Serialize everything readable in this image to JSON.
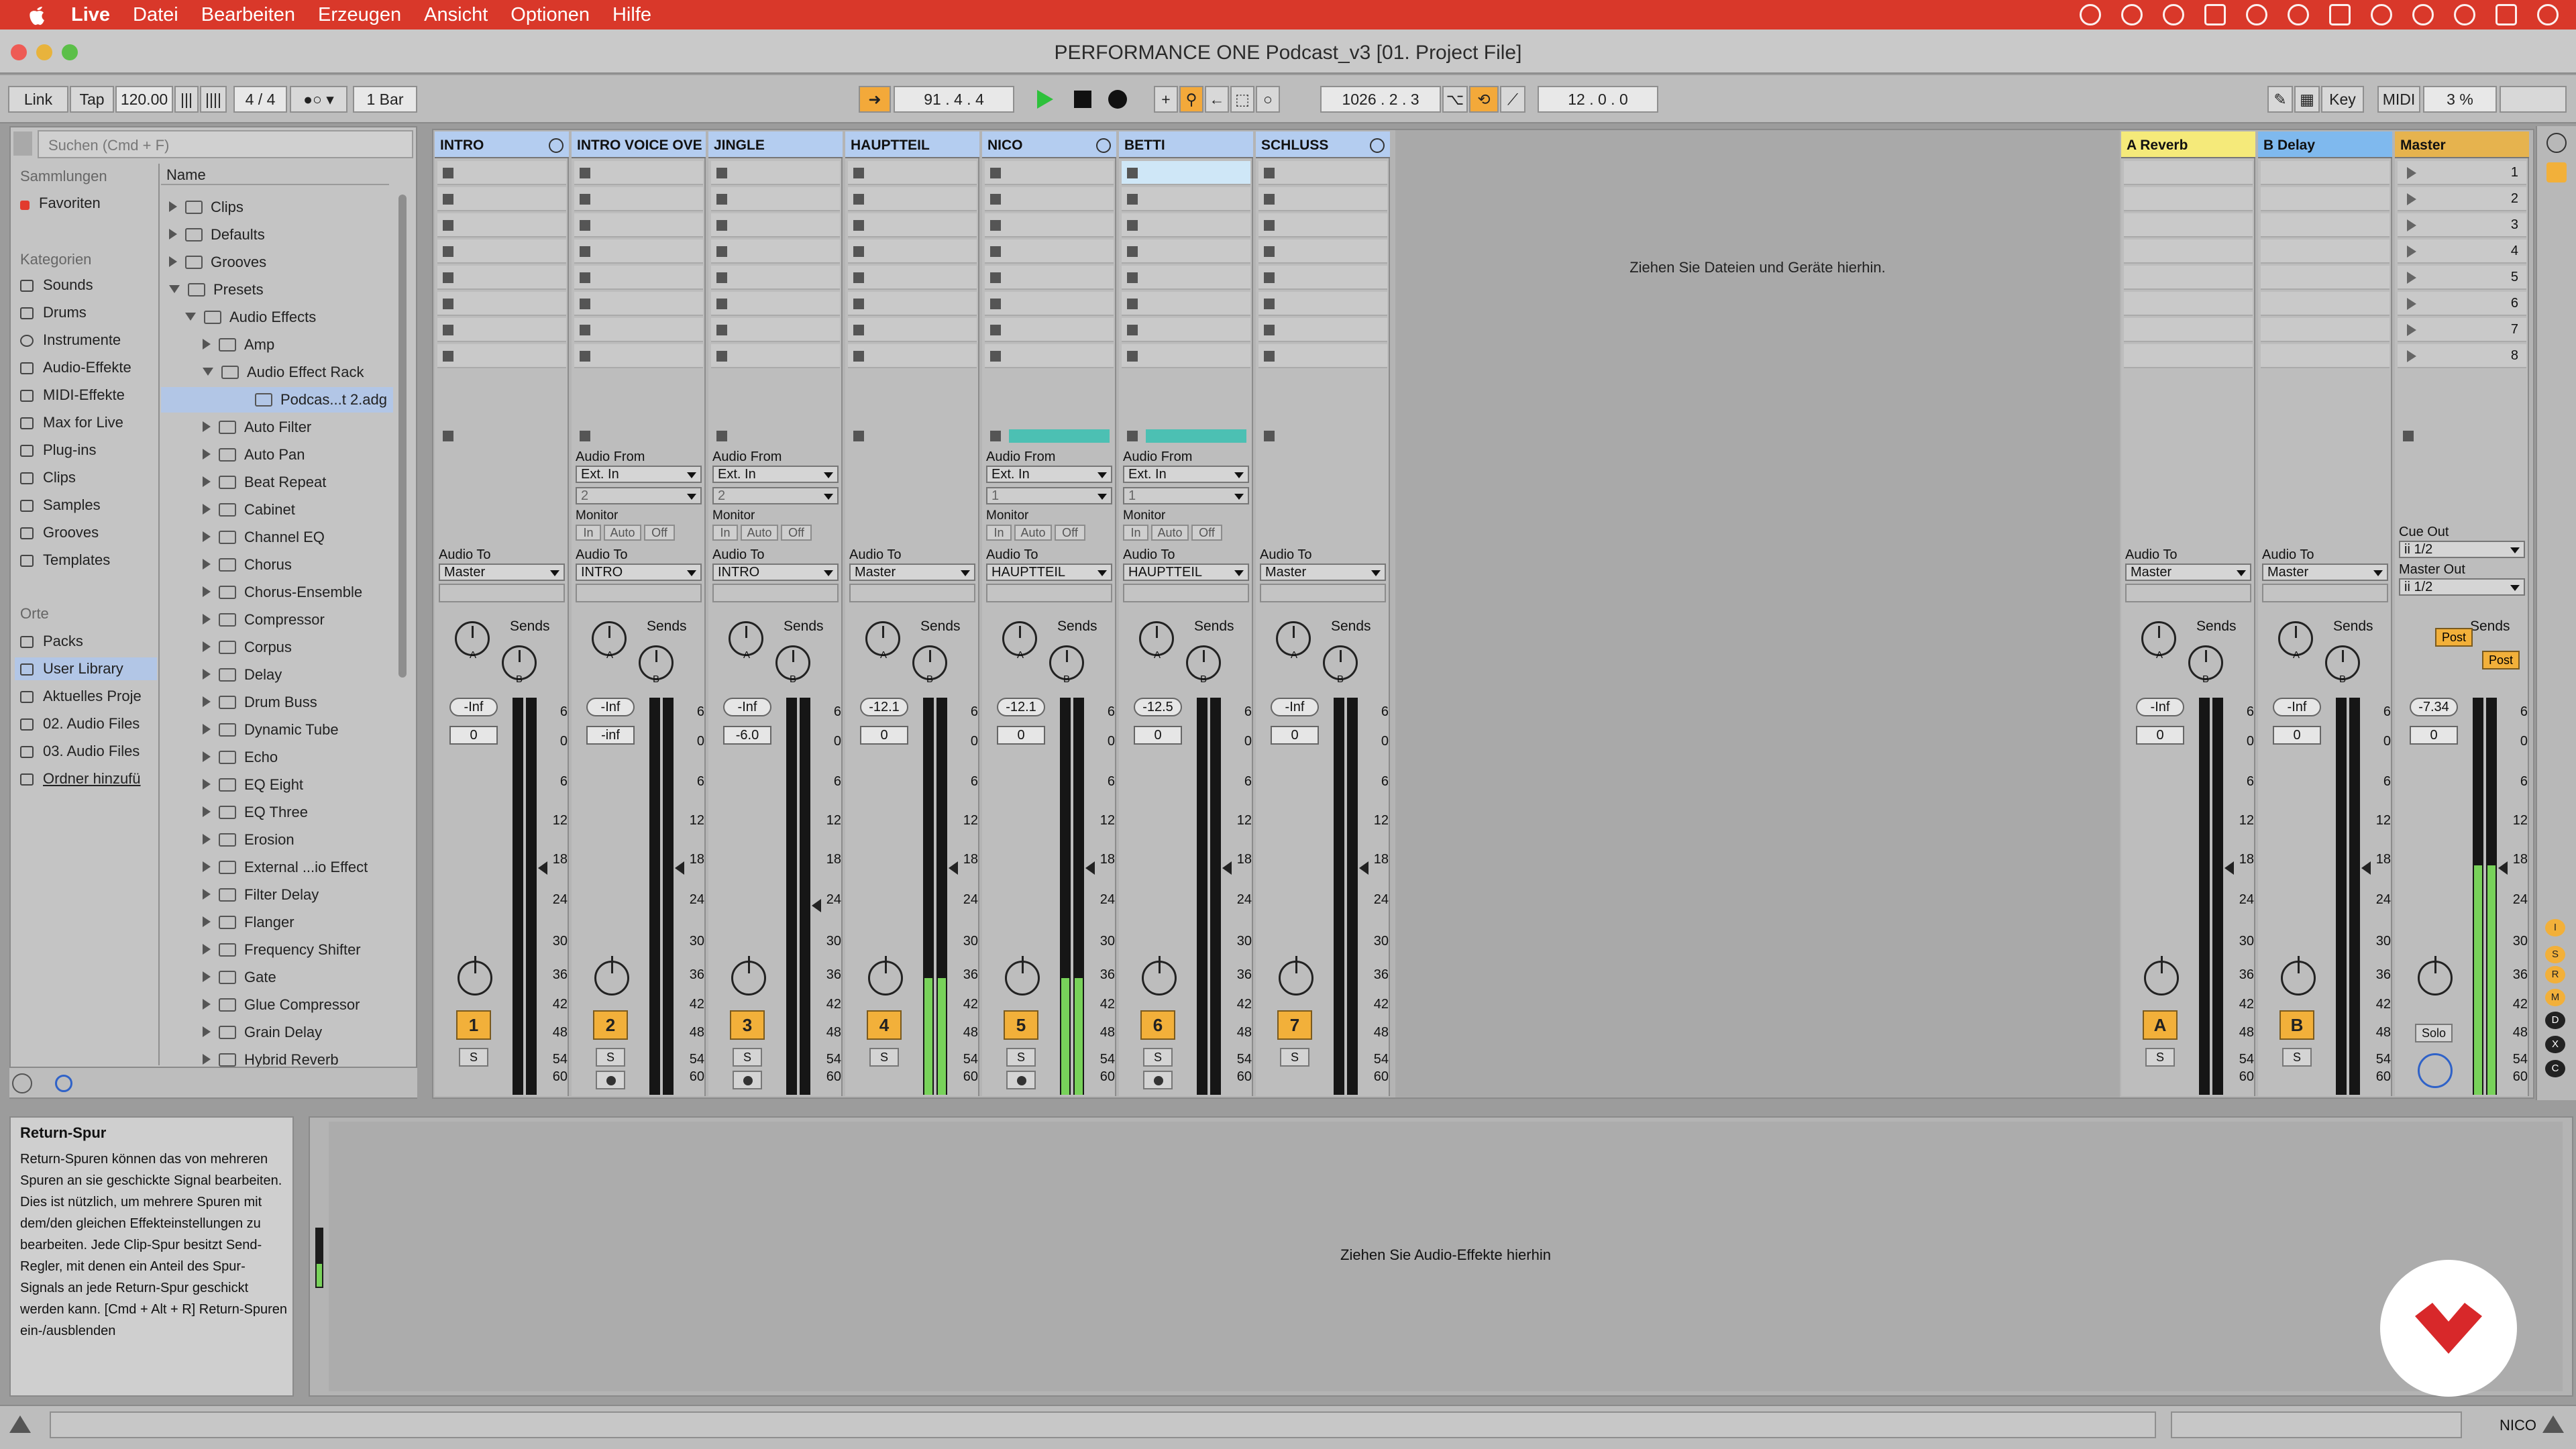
{
  "menubar": {
    "app": "Live",
    "items": [
      "Datei",
      "Bearbeiten",
      "Erzeugen",
      "Ansicht",
      "Optionen",
      "Hilfe"
    ]
  },
  "window": {
    "title": "PERFORMANCE ONE Podcast_v3  [01. Project File]"
  },
  "control_bar": {
    "link": "Link",
    "tap": "Tap",
    "tempo": "120.00",
    "signature": "4 / 4",
    "quantize": "1 Bar",
    "position": "91 .   4 .   4",
    "loop_start": "1026 .   2 .   3",
    "loop_length": "12 .   0 .   0",
    "key": "Key",
    "midi": "MIDI",
    "cpu": "3 %"
  },
  "browser": {
    "search_placeholder": "Suchen (Cmd + F)",
    "collections_header": "Sammlungen",
    "favorites": "Favoriten",
    "categories_header": "Kategorien",
    "categories": [
      "Sounds",
      "Drums",
      "Instrumente",
      "Audio-Effekte",
      "MIDI-Effekte",
      "Max for Live",
      "Plug-ins",
      "Clips",
      "Samples",
      "Grooves",
      "Templates"
    ],
    "places_header": "Orte",
    "places": [
      "Packs",
      "User Library",
      "Aktuelles Proje",
      "02. Audio Files",
      "03. Audio Files",
      "Ordner hinzufü"
    ],
    "column_name": "Name",
    "tree": [
      "Clips",
      "Defaults",
      "Grooves",
      "Presets",
      "Audio Effects",
      "Amp",
      "Audio Effect Rack",
      "Podcas...t 2.adg",
      "Auto Filter",
      "Auto Pan",
      "Beat Repeat",
      "Cabinet",
      "Channel EQ",
      "Chorus",
      "Chorus-Ensemble",
      "Compressor",
      "Corpus",
      "Delay",
      "Drum Buss",
      "Dynamic Tube",
      "Echo",
      "EQ Eight",
      "EQ Three",
      "Erosion",
      "External ...io Effect",
      "Filter Delay",
      "Flanger",
      "Frequency Shifter",
      "Gate",
      "Glue Compressor",
      "Grain Delay",
      "Hybrid Reverb"
    ]
  },
  "session": {
    "drop_hint": "Ziehen Sie Dateien und Geräte hierhin.",
    "labels": {
      "audio_from": "Audio From",
      "audio_to": "Audio To",
      "monitor": "Monitor",
      "mon_in": "In",
      "mon_auto": "Auto",
      "mon_off": "Off",
      "sends": "Sends",
      "send_a": "A",
      "send_b": "B",
      "solo": "S",
      "cue_out": "Cue Out",
      "master_out": "Master Out",
      "post": "Post",
      "solo_word": "Solo"
    },
    "scale": [
      "6",
      "0",
      "6",
      "12",
      "18",
      "24",
      "30",
      "36",
      "42",
      "48",
      "54",
      "60"
    ],
    "tracks": [
      {
        "name": "INTRO",
        "color": "#b4cdf0",
        "audio_to": "Master",
        "vol": "-Inf",
        "pan": "0",
        "num": "1"
      },
      {
        "name": "INTRO VOICE OVE",
        "color": "#b4cdf0",
        "audio_from": "Ext. In",
        "input": "2",
        "audio_to": "INTRO",
        "vol": "-Inf",
        "pan": "-inf",
        "num": "2"
      },
      {
        "name": "JINGLE",
        "color": "#b4cdf0",
        "audio_from": "Ext. In",
        "input": "2",
        "audio_to": "INTRO",
        "vol": "-Inf",
        "pan": "-6.0",
        "num": "3"
      },
      {
        "name": "HAUPTTEIL",
        "color": "#b4cdf0",
        "audio_to": "Master",
        "vol": "-12.1",
        "pan": "0",
        "num": "4"
      },
      {
        "name": "NICO",
        "color": "#b4cdf0",
        "audio_from": "Ext. In",
        "input": "1",
        "audio_to": "HAUPTTEIL",
        "vol": "-12.1",
        "pan": "0",
        "num": "5"
      },
      {
        "name": "BETTI",
        "color": "#b4cdf0",
        "audio_from": "Ext. In",
        "input": "1",
        "audio_to": "HAUPTTEIL",
        "vol": "-12.5",
        "pan": "0",
        "num": "6"
      },
      {
        "name": "SCHLUSS",
        "color": "#b4cdf0",
        "audio_to": "Master",
        "vol": "-Inf",
        "pan": "0",
        "num": "7"
      }
    ],
    "returns": [
      {
        "name": "A Reverb",
        "color": "#f5ea7a",
        "audio_to": "Master",
        "vol": "-Inf",
        "pan": "0",
        "num": "A"
      },
      {
        "name": "B Delay",
        "color": "#7fb9ee",
        "audio_to": "Master",
        "vol": "-Inf",
        "pan": "0",
        "num": "B"
      }
    ],
    "master": {
      "name": "Master",
      "color": "#e6b34e",
      "cue_out": "ii 1/2",
      "master_out": "ii 1/2",
      "vol": "-7.34",
      "pan": "0"
    },
    "scenes": [
      "1",
      "2",
      "3",
      "4",
      "5",
      "6",
      "7",
      "8"
    ]
  },
  "info": {
    "title": "Return-Spur",
    "text": "Return-Spuren können das von mehreren Spuren an sie geschickte Signal bearbeiten. Dies ist nützlich, um mehrere Spuren mit dem/den gleichen Effekteinstellungen zu bearbeiten. Jede Clip-Spur besitzt Send-Regler, mit denen ein Anteil des Spur-Signals an jede Return-Spur geschickt werden kann. [Cmd + Alt + R] Return-Spuren ein-/ausblenden"
  },
  "device": {
    "hint": "Ziehen Sie Audio-Effekte hierhin"
  },
  "status": {
    "track": "NICO"
  },
  "colors": {
    "menubar": "#d9382a",
    "accent_orange": "#f3a93a",
    "play_green": "#2ec13b",
    "meter_green": "#78d25a"
  }
}
